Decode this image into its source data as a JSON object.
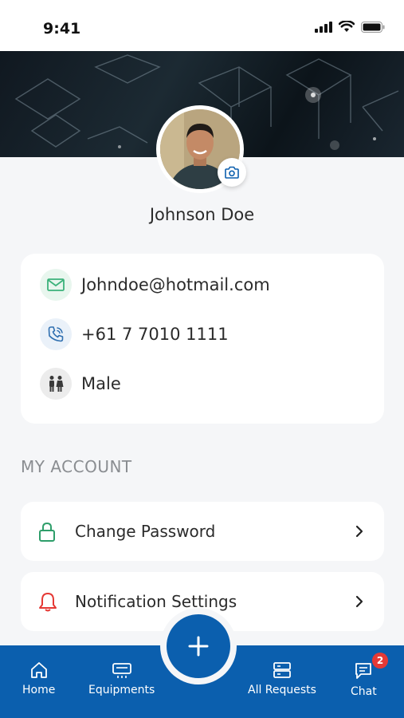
{
  "status_bar": {
    "time": "9:41"
  },
  "profile": {
    "name": "Johnson Doe"
  },
  "info": {
    "email": "Johndoe@hotmail.com",
    "phone": "+61 7 7010 1111",
    "gender": "Male"
  },
  "account": {
    "section_title": "MY ACCOUNT",
    "items": [
      {
        "label": "Change Password",
        "icon": "lock-icon"
      },
      {
        "label": "Notification Settings",
        "icon": "bell-icon"
      }
    ]
  },
  "bottom_nav": {
    "items": [
      {
        "label": "Home",
        "icon": "home-icon"
      },
      {
        "label": "Equipments",
        "icon": "equipment-icon"
      },
      {
        "label": "All Requests",
        "icon": "requests-icon"
      },
      {
        "label": "Chat",
        "icon": "chat-icon"
      }
    ],
    "chat_badge": "2",
    "fab_icon": "plus-icon"
  },
  "colors": {
    "primary": "#0b5fae",
    "email_icon": "#3bb27a",
    "phone_icon": "#2f6fb0",
    "lock_icon": "#2e9e6a",
    "bell_icon": "#e53935",
    "badge": "#e53935"
  }
}
